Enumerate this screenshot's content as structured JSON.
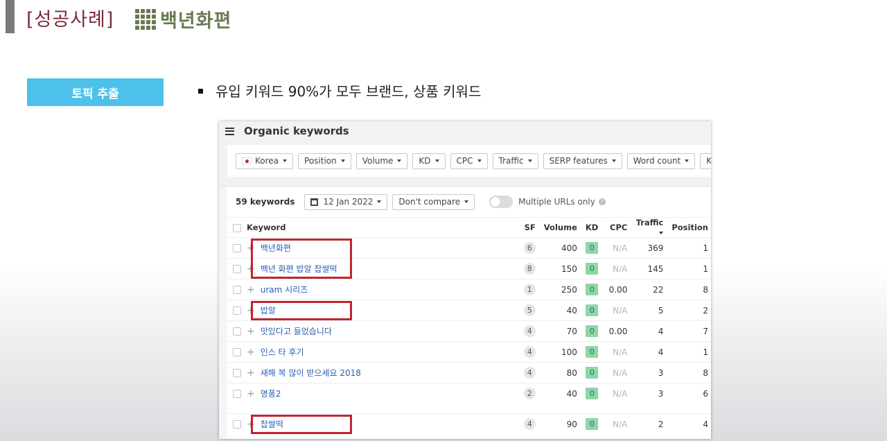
{
  "slide": {
    "title": "[성공사례]",
    "brand_name": "백년화편",
    "topic_badge": "토픽 추출",
    "bullet": "유입 키워드 90%가 모두 브랜드, 상품 키워드"
  },
  "panel": {
    "title": "Organic keywords",
    "filters": [
      {
        "label": "Korea",
        "flag": true
      },
      {
        "label": "Position"
      },
      {
        "label": "Volume"
      },
      {
        "label": "KD"
      },
      {
        "label": "CPC"
      },
      {
        "label": "Traffic"
      },
      {
        "label": "SERP features"
      },
      {
        "label": "Word count"
      },
      {
        "label": "K"
      }
    ],
    "keyword_count": "59 keywords",
    "date": "12 Jan 2022",
    "compare": "Don't compare",
    "multiple_urls_label": "Multiple URLs only",
    "multiple_urls_on": false
  },
  "table": {
    "columns": [
      "Keyword",
      "SF",
      "Volume",
      "KD",
      "CPC",
      "Traffic",
      "Position"
    ],
    "sorted_column": "Traffic",
    "rows": [
      {
        "keyword": "백년화편",
        "sf": "6",
        "volume": "400",
        "kd": "0",
        "cpc": "N/A",
        "traffic": "369",
        "position": "1",
        "highlighted": true
      },
      {
        "keyword": "백년 화편 밥알 찹쌀떡",
        "sf": "8",
        "volume": "150",
        "kd": "0",
        "cpc": "N/A",
        "traffic": "145",
        "position": "1",
        "highlighted": true
      },
      {
        "keyword": "uram 시리즈",
        "sf": "1",
        "volume": "250",
        "kd": "0",
        "cpc": "0.00",
        "traffic": "22",
        "position": "8",
        "highlighted": false
      },
      {
        "keyword": "밥알",
        "sf": "5",
        "volume": "40",
        "kd": "0",
        "cpc": "N/A",
        "traffic": "5",
        "position": "2",
        "highlighted": true
      },
      {
        "keyword": "맛있다고 들었습니다",
        "sf": "4",
        "volume": "70",
        "kd": "0",
        "cpc": "0.00",
        "traffic": "4",
        "position": "7",
        "highlighted": false
      },
      {
        "keyword": "인스 타 후기",
        "sf": "4",
        "volume": "100",
        "kd": "0",
        "cpc": "N/A",
        "traffic": "4",
        "position": "1",
        "highlighted": false
      },
      {
        "keyword": "새해 복 많이 받으세요 2018",
        "sf": "4",
        "volume": "80",
        "kd": "0",
        "cpc": "N/A",
        "traffic": "3",
        "position": "8",
        "highlighted": false
      },
      {
        "keyword": "명품2",
        "sf": "2",
        "volume": "40",
        "kd": "0",
        "cpc": "N/A",
        "traffic": "3",
        "position": "6",
        "highlighted": false
      },
      {
        "keyword": "찹쌀떡",
        "sf": "4",
        "volume": "90",
        "kd": "0",
        "cpc": "N/A",
        "traffic": "2",
        "position": "4",
        "highlighted": true
      }
    ]
  },
  "colors": {
    "title": "#7b2a3a",
    "brand": "#6a7a52",
    "topic_badge": "#4dc1ea",
    "highlight_box": "#c0252d",
    "link": "#2a5db0",
    "kd_badge": "#8fd6a9"
  }
}
